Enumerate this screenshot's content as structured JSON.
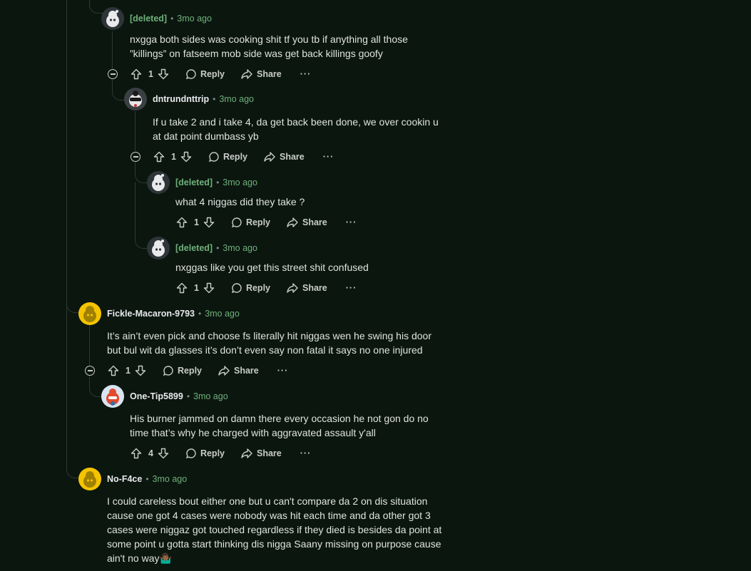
{
  "comments": [
    {
      "user": "[deleted]",
      "time": "3mo ago",
      "lines": [
        "nxgga both sides was cooking shit tf you tb if anything all those",
        "”killings” on fatseem mob side was get back killings goofy"
      ],
      "votes": "1",
      "reply": "Reply",
      "share": "Share",
      "more": "···"
    },
    {
      "user": "dntrundnttrip",
      "time": "3mo ago",
      "lines": [
        "If u take 2 and i take 4, da get back been done, we over cookin u",
        "at dat point dumbass yb"
      ],
      "votes": "1",
      "reply": "Reply",
      "share": "Share",
      "more": "···"
    },
    {
      "user": "[deleted]",
      "time": "3mo ago",
      "lines": [
        "what 4 niggas did they take ?"
      ],
      "votes": "1",
      "reply": "Reply",
      "share": "Share",
      "more": "···"
    },
    {
      "user": "[deleted]",
      "time": "3mo ago",
      "lines": [
        "nxggas like you get this street shit confused"
      ],
      "votes": "1",
      "reply": "Reply",
      "share": "Share",
      "more": "···"
    },
    {
      "user": "Fickle-Macaron-9793",
      "time": "3mo ago",
      "lines": [
        "It’s ain’t even pick and choose fs literally hit niggas wen he swing his door",
        "but bul wit da glasses it’s don’t even say non fatal it says no one injured"
      ],
      "votes": "1",
      "reply": "Reply",
      "share": "Share",
      "more": "···"
    },
    {
      "user": "One-Tip5899",
      "time": "3mo ago",
      "lines": [
        "His burner jammed on damn there every occasion he not gon do no",
        "time that’s why he charged with aggravated assault y'all"
      ],
      "votes": "4",
      "reply": "Reply",
      "share": "Share",
      "more": "···"
    },
    {
      "user": "No-F4ce",
      "time": "3mo ago",
      "lines": [
        "I could careless bout either one but u can't compare da 2 on dis situation",
        "cause one got 4 cases were nobody was hit each time and da other got 3",
        "cases were niggaz got touched regardless if they died is besides da point at",
        "some point u gotta start thinking dis nigga Saany missing on purpose cause",
        "ain't no way🤷🏾‍♂️"
      ]
    }
  ],
  "colors": {
    "background": "#0b160f",
    "accent": "#6fb07a",
    "thread": "#2c3a31"
  },
  "icons": [
    "upvote-icon",
    "downvote-icon",
    "comment-icon",
    "share-icon",
    "collapse-icon",
    "snoo-avatar-icon"
  ]
}
